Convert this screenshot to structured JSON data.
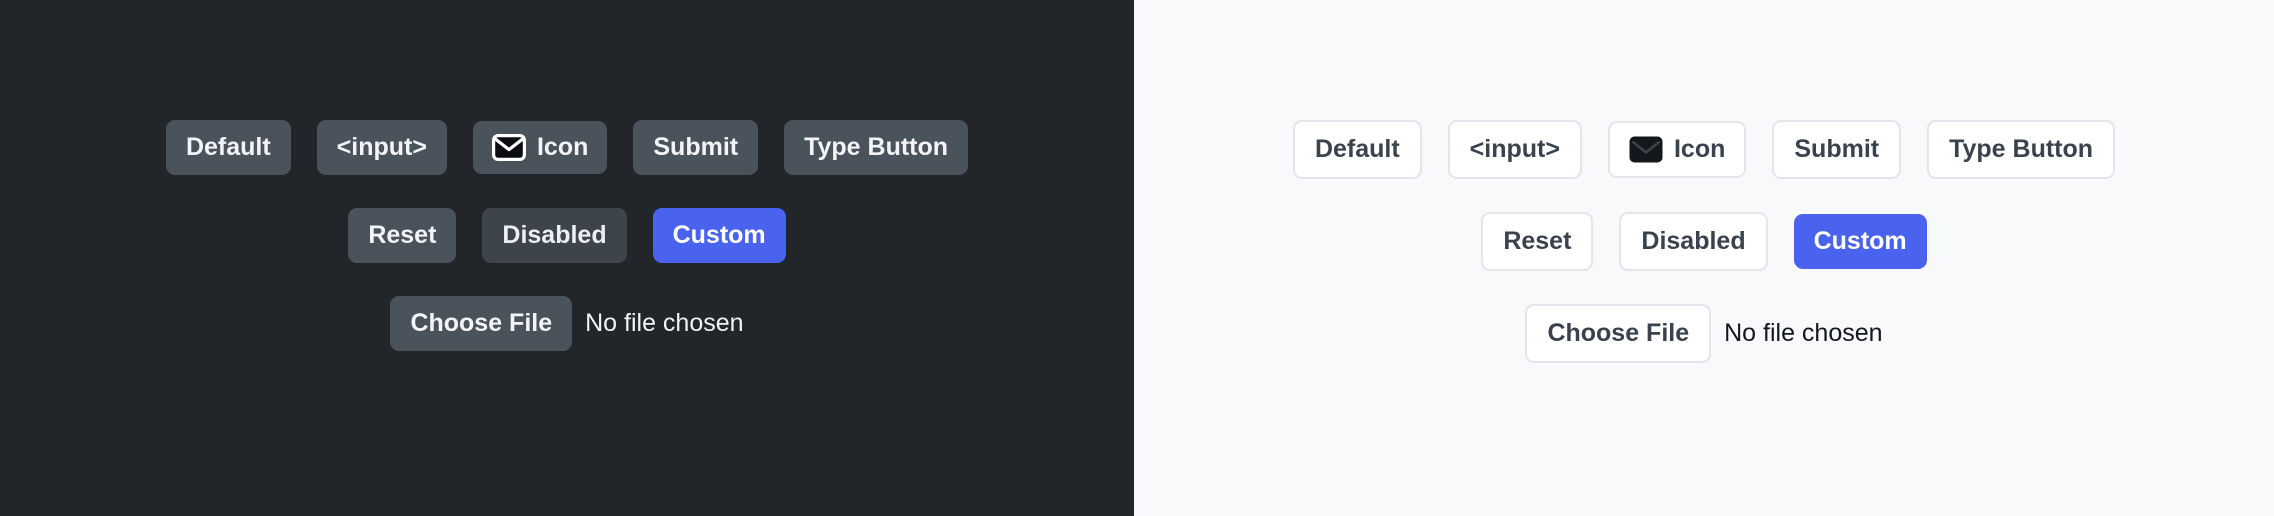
{
  "themes": {
    "dark": {
      "name": "dark-theme-panel",
      "background": "#22262b",
      "button_bg": "#4a525c",
      "button_text": "#f2f4f7",
      "disabled_bg": "#3e444c",
      "custom_bg": "#4a63ee",
      "custom_text": "#ffffff",
      "row1": [
        {
          "label": "Default",
          "name": "default-button"
        },
        {
          "label": "<input>",
          "name": "input-button"
        },
        {
          "label": "Icon",
          "name": "icon-button",
          "icon": "envelope-icon"
        },
        {
          "label": "Submit",
          "name": "submit-button"
        },
        {
          "label": "Type Button",
          "name": "type-button"
        }
      ],
      "row2": [
        {
          "label": "Reset",
          "name": "reset-button"
        },
        {
          "label": "Disabled",
          "name": "disabled-button"
        },
        {
          "label": "Custom",
          "name": "custom-button"
        }
      ],
      "file_input": {
        "button_label": "Choose File",
        "status_text": "No file chosen"
      }
    },
    "light": {
      "name": "light-theme-panel",
      "background": "#f8f9fb",
      "button_bg": "#ffffff",
      "button_text": "#3a424d",
      "border_color": "#e2e5ea",
      "custom_bg": "#4a63ee",
      "custom_text": "#ffffff",
      "row1": [
        {
          "label": "Default",
          "name": "default-button"
        },
        {
          "label": "<input>",
          "name": "input-button"
        },
        {
          "label": "Icon",
          "name": "icon-button",
          "icon": "envelope-icon"
        },
        {
          "label": "Submit",
          "name": "submit-button"
        },
        {
          "label": "Type Button",
          "name": "type-button"
        }
      ],
      "row2": [
        {
          "label": "Reset",
          "name": "reset-button"
        },
        {
          "label": "Disabled",
          "name": "disabled-button"
        },
        {
          "label": "Custom",
          "name": "custom-button"
        }
      ],
      "file_input": {
        "button_label": "Choose File",
        "status_text": "No file chosen"
      }
    }
  }
}
